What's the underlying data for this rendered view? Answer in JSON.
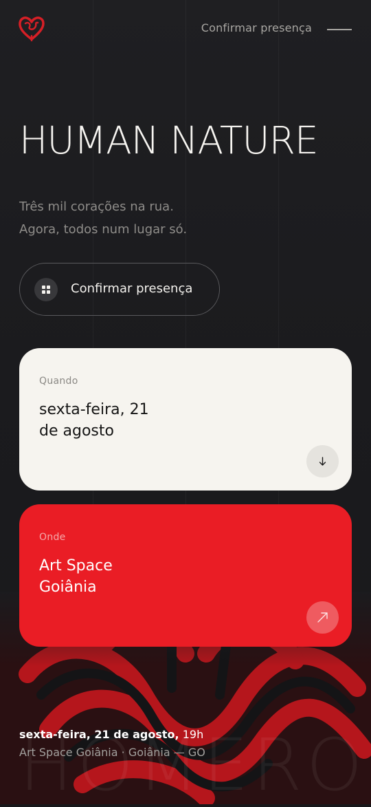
{
  "header": {
    "logo_icon": "heart-logo-icon",
    "nav_label": "Confirmar presença",
    "menu_icon": "menu-line-icon"
  },
  "hero": {
    "title": "HUMAN NATURE",
    "tagline_line1": "Três mil corações na rua.",
    "tagline_line2": "Agora, todos num lugar só."
  },
  "cta": {
    "label": "Confirmar presença",
    "icon": "grid-icon"
  },
  "cards": {
    "when": {
      "label": "Quando",
      "value_line1": "sexta-feira, 21",
      "value_line2": "de agosto",
      "button_icon": "arrow-down-icon"
    },
    "where": {
      "label": "Onde",
      "value_line1": "Art Space",
      "value_line2": "Goiânia",
      "button_icon": "arrow-up-right-icon"
    }
  },
  "footer": {
    "date": "sexta-feira, 21 de agosto",
    "separator": ",",
    "time": "19h",
    "location": "Art Space Goiânia · Goiânia — GO"
  },
  "watermark": "HOMERO",
  "colors": {
    "background": "#1c1c1f",
    "accent_red": "#ea1d25",
    "card_light": "#f6f4ef",
    "text_light": "#f4f2ee"
  }
}
